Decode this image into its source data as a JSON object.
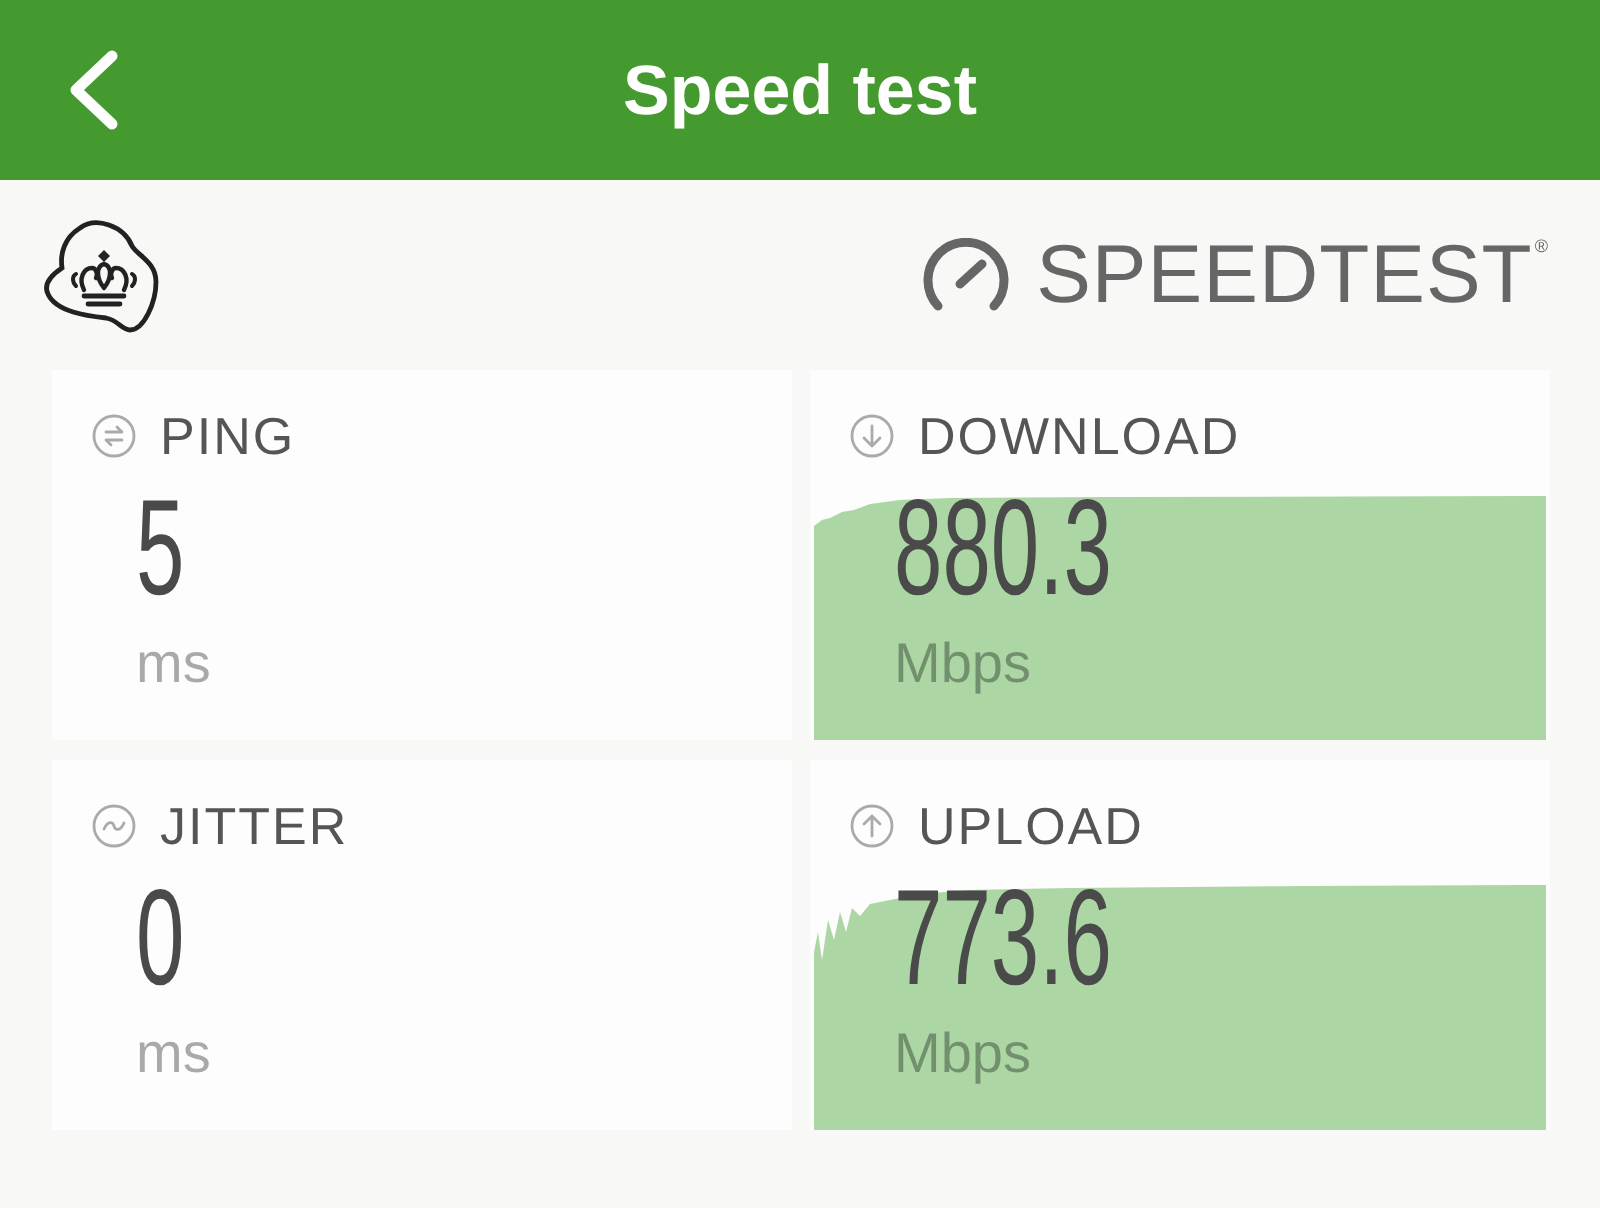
{
  "header": {
    "title": "Speed test"
  },
  "brand": {
    "text": "SPEEDTEST$^{®}$"
  },
  "metrics": [
    {
      "kind": "ping",
      "label": "PING",
      "value": "5",
      "unit": "ms"
    },
    {
      "kind": "download",
      "label": "DOWNLOAD",
      "value": "880.3",
      "unit": "Mbps"
    },
    {
      "kind": "jitter",
      "label": "JITTER",
      "value": "0",
      "unit": "ms"
    },
    {
      "kind": "upload",
      "label": "UPLOAD",
      "value": "773.6",
      "unit": "Mbps"
    }
  ]
}
